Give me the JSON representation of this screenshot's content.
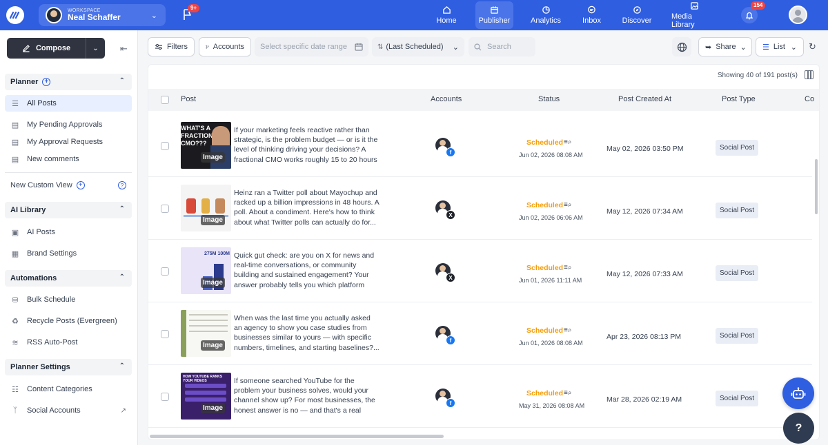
{
  "colors": {
    "primary": "#2f5ee0",
    "scheduled": "#f59e0b",
    "facebook": "#1877f2",
    "x": "#1f2329"
  },
  "topbar": {
    "workspace_label": "WORKSPACE",
    "workspace_name": "Neal Schaffer",
    "flag_badge": "9+",
    "notif_badge": "154",
    "nav": [
      {
        "label": "Home",
        "icon": "home-icon"
      },
      {
        "label": "Publisher",
        "icon": "calendar-icon"
      },
      {
        "label": "Analytics",
        "icon": "analytics-icon"
      },
      {
        "label": "Inbox",
        "icon": "inbox-icon"
      },
      {
        "label": "Discover",
        "icon": "compass-icon"
      },
      {
        "label": "Media Library",
        "icon": "media-icon"
      }
    ]
  },
  "sidebar": {
    "compose_label": "Compose",
    "planner": "Planner",
    "all_posts": "All Posts",
    "pending": "My Pending Approvals",
    "approval_requests": "My Approval Requests",
    "new_comments": "New comments",
    "new_custom_view": "New Custom View",
    "ai_library": "AI Library",
    "ai_posts": "AI Posts",
    "brand_settings": "Brand Settings",
    "automations": "Automations",
    "bulk_schedule": "Bulk Schedule",
    "recycle_posts": "Recycle Posts (Evergreen)",
    "rss": "RSS Auto-Post",
    "planner_settings": "Planner Settings",
    "content_categories": "Content Categories",
    "social_accounts": "Social Accounts"
  },
  "toolbar": {
    "filters": "Filters",
    "accounts": "Accounts",
    "date_placeholder": "Select specific date range",
    "sort": "(Last Scheduled)",
    "search_placeholder": "Search",
    "share": "Share",
    "view": "List"
  },
  "table": {
    "showing": "Showing 40 of 191 post(s)",
    "headers": {
      "post": "Post",
      "accounts": "Accounts",
      "status": "Status",
      "created": "Post Created At",
      "type": "Post Type",
      "extra": "Co"
    },
    "image_tag": "Image",
    "rows": [
      {
        "text": "If your marketing feels reactive rather than strategic, is the problem budget — or is it the level of thinking driving your decisions? A fractional CMO works roughly 15 to 20 hours a...",
        "network": "f",
        "status": "Scheduled",
        "scheduled_at": "Jun 02, 2026 08:08 AM",
        "created_at": "May 02, 2026 03:50 PM",
        "type": "Social Post",
        "thumb_text": "WHAT'S A FRACTIONAL CMO???"
      },
      {
        "text": "Heinz ran a Twitter poll about Mayochup and racked up a billion impressions in 48 hours. A poll. About a condiment. Here's how to think about what Twitter polls can actually do for...",
        "network": "X",
        "status": "Scheduled",
        "scheduled_at": "Jun 02, 2026 06:06 AM",
        "created_at": "May 12, 2026 07:34 AM",
        "type": "Social Post",
        "thumb_text": ""
      },
      {
        "text": "Quick gut check: are you on X for news and real-time conversations, or community building and sustained engagement? Your answer probably tells you which platform deserves more of you...",
        "network": "X",
        "status": "Scheduled",
        "scheduled_at": "Jun 01, 2026 11:11 AM",
        "created_at": "May 12, 2026 07:33 AM",
        "type": "Social Post",
        "thumb_text": "275M 100M"
      },
      {
        "text": "When was the last time you actually asked an agency to show you case studies from businesses similar to yours — with specific numbers, timelines, and starting baselines?...",
        "network": "f",
        "status": "Scheduled",
        "scheduled_at": "Jun 01, 2026 08:08 AM",
        "created_at": "Apr 23, 2026 08:13 PM",
        "type": "Social Post",
        "thumb_text": ""
      },
      {
        "text": "If someone searched YouTube for the problem your business solves, would your channel show up? For most businesses, the honest answer is no — and that's a real missed opportunity,...",
        "network": "f",
        "status": "Scheduled",
        "scheduled_at": "May 31, 2026 08:08 AM",
        "created_at": "Mar 28, 2026 02:19 AM",
        "type": "Social Post",
        "thumb_text": "HOW YOUTUBE RANKS YOUR VIDEOS"
      }
    ]
  },
  "help_label": "?"
}
